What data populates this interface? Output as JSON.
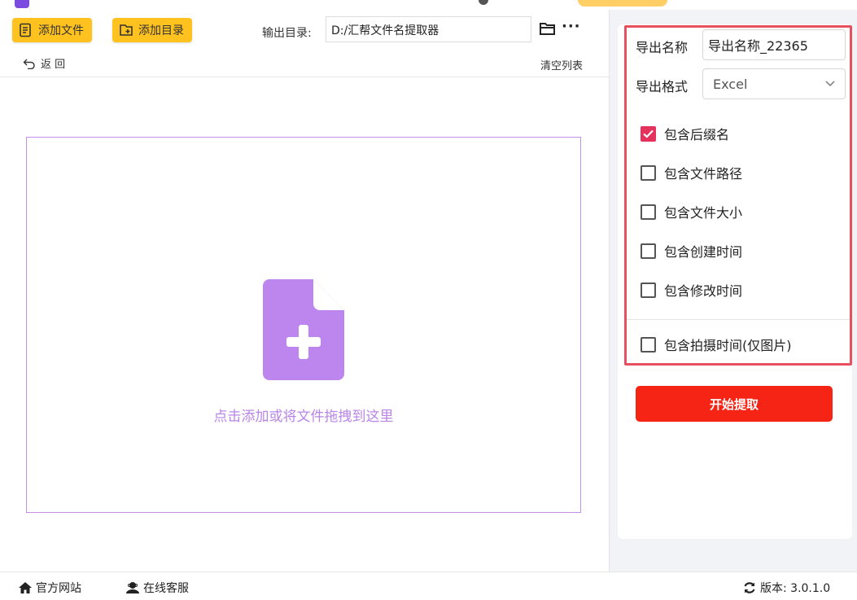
{
  "toolbar": {
    "add_file_label": "添加文件",
    "add_dir_label": "添加目录",
    "output_dir_label": "输出目录:",
    "output_dir_value": "D:/汇帮文件名提取器",
    "more_label": "···",
    "back_label": "返  回",
    "clear_label": "清空列表"
  },
  "dropzone": {
    "hint": "点击添加或将文件拖拽到这里"
  },
  "settings": {
    "export_name_label": "导出名称",
    "export_name_value": "导出名称_22365",
    "export_format_label": "导出格式",
    "export_format_value": "Excel",
    "options": [
      {
        "label": "包含后缀名",
        "checked": true
      },
      {
        "label": "包含文件路径",
        "checked": false
      },
      {
        "label": "包含文件大小",
        "checked": false
      },
      {
        "label": "包含创建时间",
        "checked": false
      },
      {
        "label": "包含修改时间",
        "checked": false
      },
      {
        "label": "包含拍摄时间(仅图片)",
        "checked": false
      }
    ],
    "start_label": "开始提取"
  },
  "statusbar": {
    "website_label": "官方网站",
    "support_label": "在线客服",
    "version_label": "版本: 3.0.1.0"
  },
  "colors": {
    "accent_yellow": "#ffc21e",
    "highlight_red": "#e9505e",
    "start_red": "#f52414",
    "drop_purple": "#b985e8",
    "checkbox_pink": "#e4325c"
  }
}
